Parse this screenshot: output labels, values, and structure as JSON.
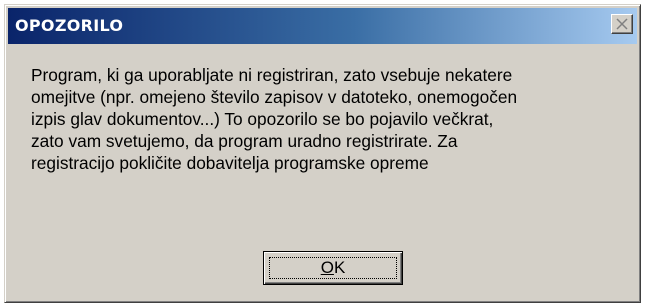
{
  "dialog": {
    "title": "OPOZORILO",
    "message": "Program, ki ga uporabljate ni registriran, zato vsebuje nekatere\nomejitve (npr. omejeno število zapisov v datoteko, onemogočen\nizpis glav dokumentov...) To opozorilo se bo pojavilo večkrat,\nzato vam svetujemo, da program uradno registrirate. Za\nregistracijo pokličite dobavitelja programske opreme",
    "ok_mnemonic": "O",
    "ok_rest": "K",
    "close_icon": "close-icon"
  },
  "colors": {
    "titlebar_start": "#0a246a",
    "titlebar_end": "#a6caf0",
    "face": "#d4d0c8"
  }
}
